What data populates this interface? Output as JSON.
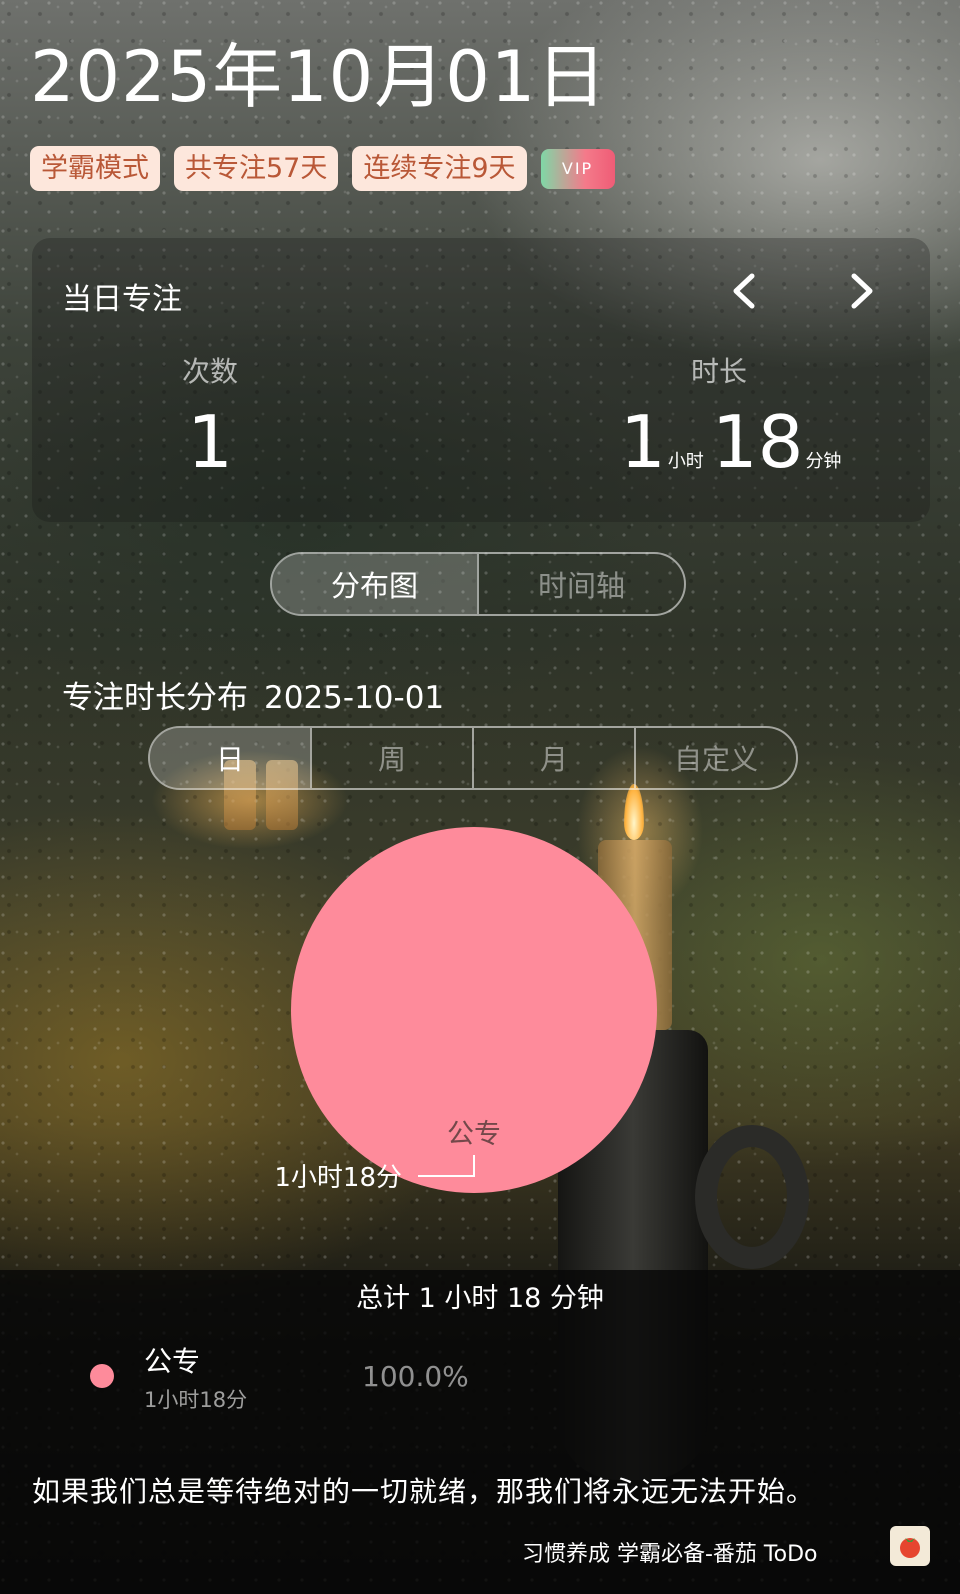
{
  "header": {
    "date": "2025年10月01日"
  },
  "badges": [
    "学霸模式",
    "共专注57天",
    "连续专注9天"
  ],
  "vip_badge": "VIP",
  "daily": {
    "title": "当日专注",
    "count_label": "次数",
    "count_value": "1",
    "duration_label": "时长",
    "hours": "1",
    "hours_unit": "小时",
    "minutes": "18",
    "minutes_unit": "分钟"
  },
  "view_toggle": {
    "options": [
      "分布图",
      "时间轴"
    ],
    "selected": "分布图"
  },
  "distribution": {
    "title": "专注时长分布",
    "date": "2025-10-01"
  },
  "range_tabs": {
    "options": [
      "日",
      "周",
      "月",
      "自定义"
    ],
    "selected": "日"
  },
  "chart_data": {
    "type": "pie",
    "categories": [
      "公专"
    ],
    "values": [
      78
    ],
    "value_labels": [
      "1小时18分"
    ],
    "colors": [
      "#fe8b9b"
    ]
  },
  "total_text": "总计 1 小时 18 分钟",
  "legend": [
    {
      "name": "公专",
      "duration": "1小时18分",
      "percent": "100.0%",
      "color": "#fe8b9b"
    }
  ],
  "quote": "如果我们总是等待绝对的一切就绪，那我们将永远无法开始。",
  "footer": {
    "text": "习惯养成 学霸必备-番茄 ToDo",
    "logo_icon": "tomato-icon"
  }
}
